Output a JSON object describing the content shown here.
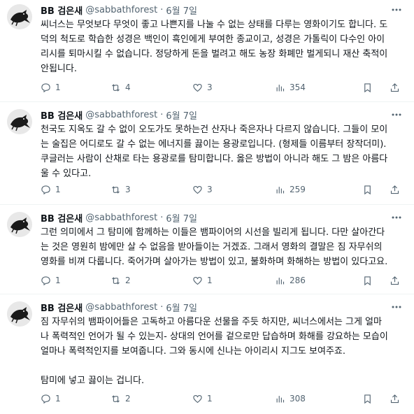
{
  "tweets": [
    {
      "name": "BB 검은새",
      "handle": "@sabbathforest",
      "date": "6월 7일",
      "text": "씨너스는 무엇보다 무엇이 좋고 나쁜지를 나눌 수 없는 상태를 다루는 영화이기도 합니다. 도\n덕의 척도로 학습한 성경은 백인이 흑인에게 부여한 종교이고, 성경은 가톨릭이 다수인 아이\n리시를 퇴마시킬 수 없습니다. 정당하게 돈을 벌려고 해도 농장 화폐만 벌게되니 재산 축적이\n안됩니다.",
      "replies": "1",
      "retweets": "4",
      "likes": "3",
      "views": "354"
    },
    {
      "name": "BB 검은새",
      "handle": "@sabbathforest",
      "date": "6월 7일",
      "text": "천국도 지옥도 갈 수 없이 오도가도 못하는건 산자나 죽은자나 다르지 않습니다. 그들이 모이\n는 술집은 어디로도 갈 수 없는 에너지를 끓이는 용광로입니다. (형제들 이름부터 장작더미).\n쿠글러는 사람이 산채로 타는 용광로를 탐미합니다. 옳은 방법이 아니라 해도 그 밤은 아름다\n울 수 있다고.",
      "replies": "1",
      "retweets": "3",
      "likes": "3",
      "views": "259"
    },
    {
      "name": "BB 검은새",
      "handle": "@sabbathforest",
      "date": "6월 7일",
      "text": "그런 의미에서 그 탐미에 함께하는 이들은 뱀파이어의 시선을 빌리게 됩니다. 다만 살아간다\n는 것은 영원히 밤에만 살 수 없음을 받아들이는 거겠죠. 그래서 영화의 결말은 짐 자무쉬의\n영화를 비껴 다룹니다. 죽어가며 살아가는 방법이 있고, 불화하며 화해하는 방법이 있다고요.",
      "replies": "1",
      "retweets": "2",
      "likes": "1",
      "views": "286"
    },
    {
      "name": "BB 검은새",
      "handle": "@sabbathforest",
      "date": "6월 7일",
      "text": "짐 자무쉬의 뱀파이어들은 고독하고 아름다운 선물을 주듯 하지만, 씨너스에서는 그게 얼마\n나 폭력적인 언어가 될 수 있는지- 상대의 언어를 겉으로만 답습하며 화해를 강요하는 모습이\n얼마나 폭력적인지를 보여줍니다. 그와 동시에 신나는 아이리시 지그도 보여주죠.\n\n탐미에 넣고 끓이는 겁니다.",
      "replies": "1",
      "retweets": "2",
      "likes": "1",
      "views": "308"
    }
  ]
}
